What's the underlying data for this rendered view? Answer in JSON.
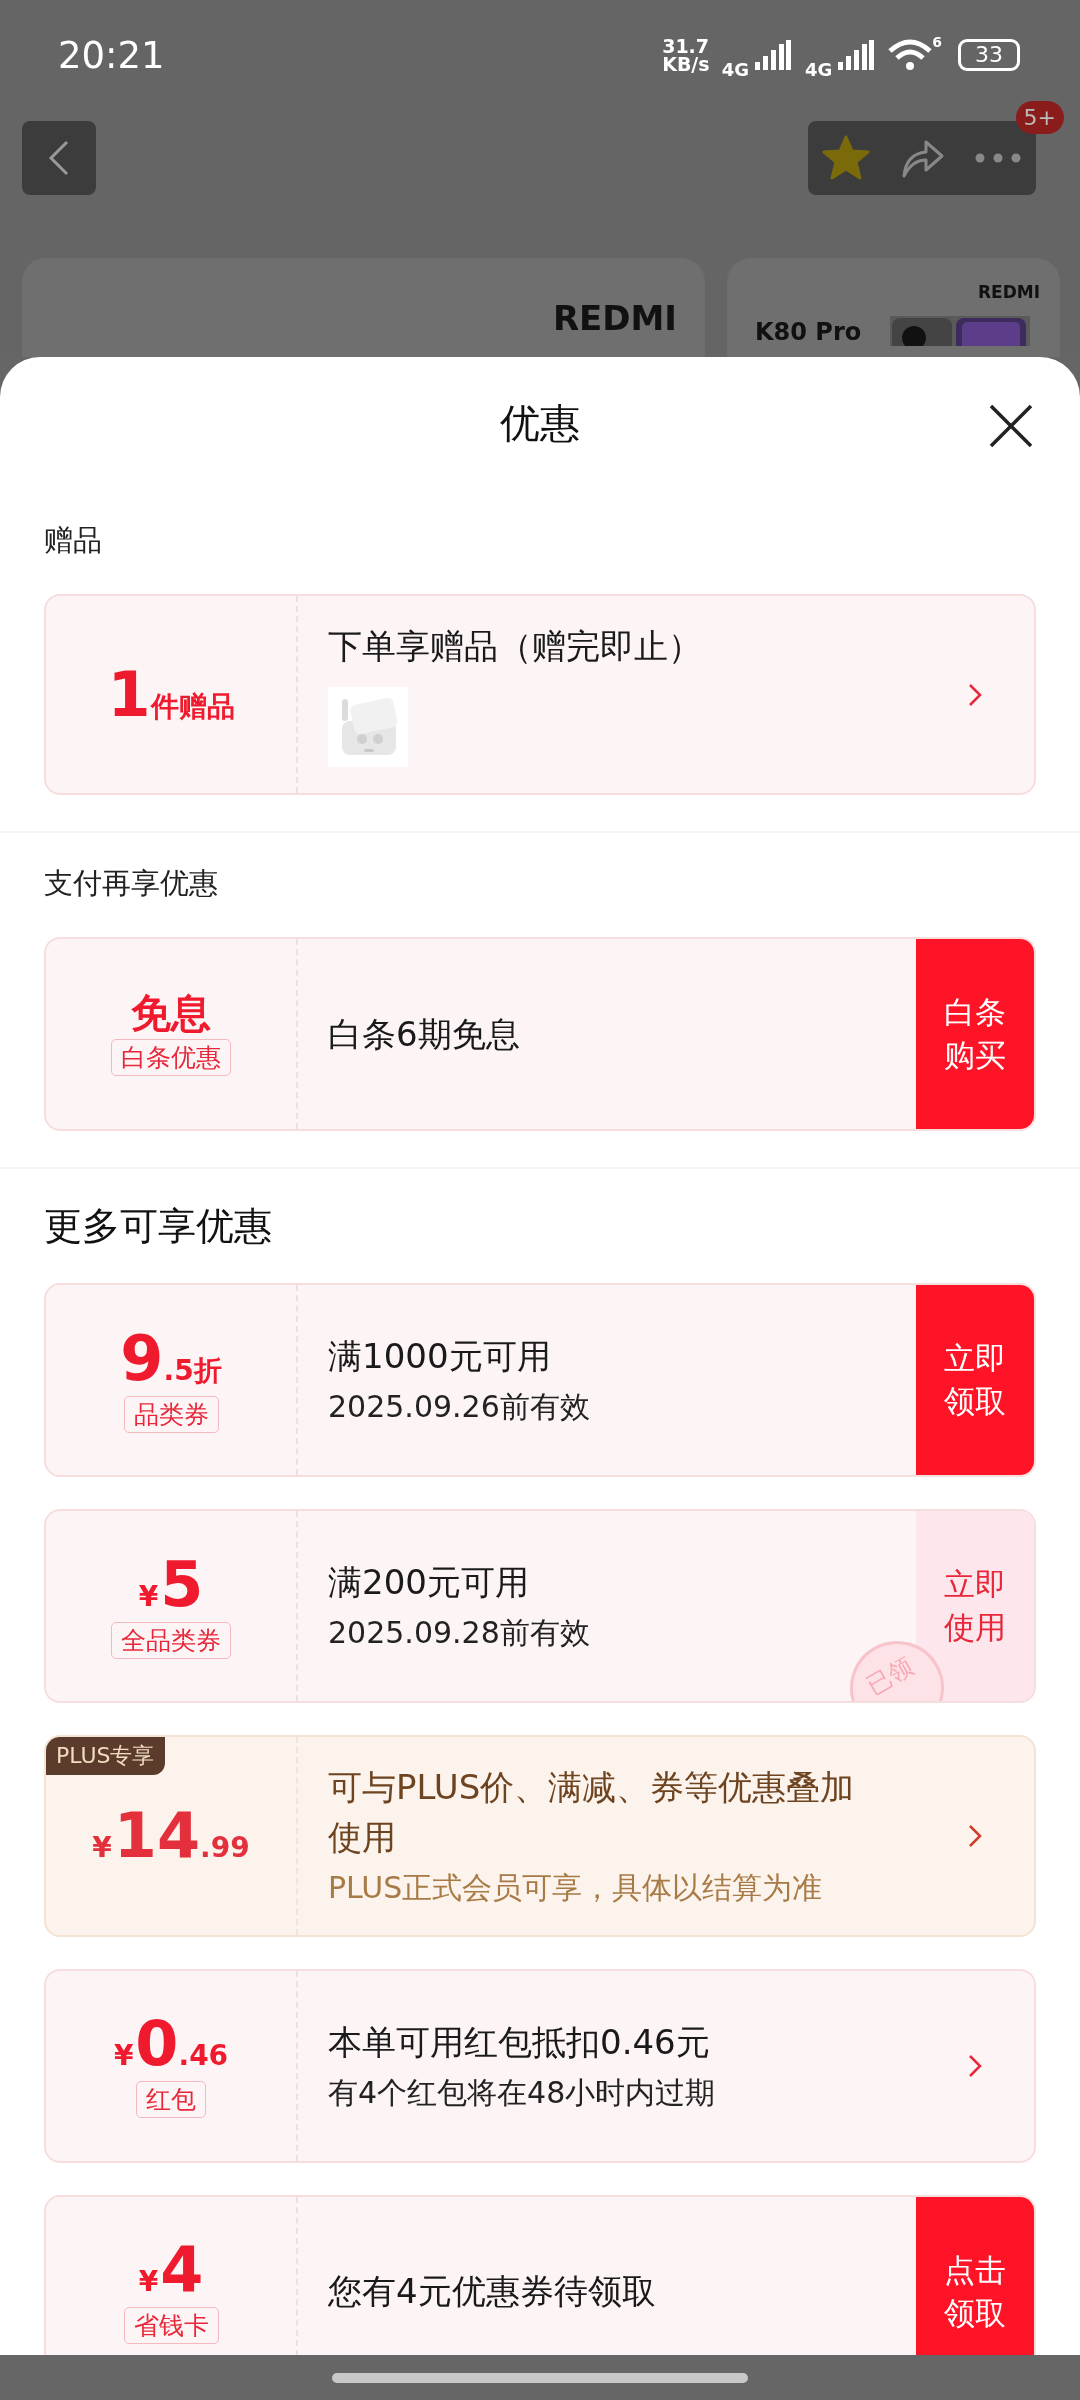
{
  "status_bar": {
    "time": "20:21",
    "net_speed": "31.7",
    "net_speed_unit": "KB/s",
    "networks": [
      "4G",
      "4G"
    ],
    "wifi_label": "6",
    "battery": "33"
  },
  "header": {
    "favorited": true,
    "notification_badge": "5+"
  },
  "background_products": [
    {
      "brand": "REDMI"
    },
    {
      "brand": "REDMI",
      "model": "K80 Pro"
    }
  ],
  "sheet": {
    "title": "优惠"
  },
  "sections": [
    {
      "title": "赠品",
      "emphasis": false,
      "offers": [
        {
          "kind": "gift",
          "value": [
            {
              "text": "1",
              "kind": "large"
            },
            {
              "text": "件赠品",
              "kind": "small"
            }
          ],
          "title": "下单享赠品（赠完即止）",
          "thumbnail": {
            "kind": "picture"
          },
          "action": {
            "kind": "chevron"
          }
        }
      ]
    },
    {
      "title": "支付再享优惠",
      "emphasis": false,
      "offers": [
        {
          "kind": "payment",
          "value": [
            {
              "text": "免息",
              "kind": "medium"
            }
          ],
          "tag": "白条优惠",
          "title": "白条6期免息",
          "action": {
            "kind": "button",
            "label": "白条购买",
            "filled": true
          }
        }
      ]
    },
    {
      "title": "更多可享优惠",
      "emphasis": true,
      "offers": [
        {
          "kind": "coupon",
          "value": [
            {
              "text": "9",
              "kind": "large"
            },
            {
              "text": ".5折",
              "kind": "small"
            }
          ],
          "tag": "品类券",
          "title": "满1000元可用",
          "subtitle": "2025.09.26前有效",
          "action": {
            "kind": "button",
            "label": "立即领取",
            "filled": true
          }
        },
        {
          "kind": "coupon",
          "value": [
            {
              "text": "¥",
              "kind": "currency"
            },
            {
              "text": "5",
              "kind": "large"
            }
          ],
          "tag": "全品类券",
          "title": "满200元可用",
          "subtitle": "2025.09.28前有效",
          "stamp": "已领",
          "action": {
            "kind": "button",
            "label": "立即使用",
            "filled": false
          }
        },
        {
          "kind": "plus",
          "badge": "PLUS专享",
          "value": [
            {
              "text": "¥",
              "kind": "currency"
            },
            {
              "text": "14",
              "kind": "large"
            },
            {
              "text": ".99",
              "kind": "small"
            }
          ],
          "title": "可与PLUS价、满减、券等优惠叠加使用",
          "subtitle": "PLUS正式会员可享，具体以结算为准",
          "action": {
            "kind": "chevron"
          }
        },
        {
          "kind": "redpacket",
          "value": [
            {
              "text": "¥",
              "kind": "currency"
            },
            {
              "text": "0",
              "kind": "large"
            },
            {
              "text": ".46",
              "kind": "small"
            }
          ],
          "tag": "红包",
          "title": "本单可用红包抵扣0.46元",
          "subtitle": "有4个红包将在48小时内过期",
          "action": {
            "kind": "chevron"
          }
        },
        {
          "kind": "savings",
          "value": [
            {
              "text": "¥",
              "kind": "currency"
            },
            {
              "text": "4",
              "kind": "large"
            }
          ],
          "tag": "省钱卡",
          "title": "您有4元优惠券待领取",
          "action": {
            "kind": "button",
            "label": "点击领取",
            "filled": true
          }
        }
      ]
    }
  ]
}
